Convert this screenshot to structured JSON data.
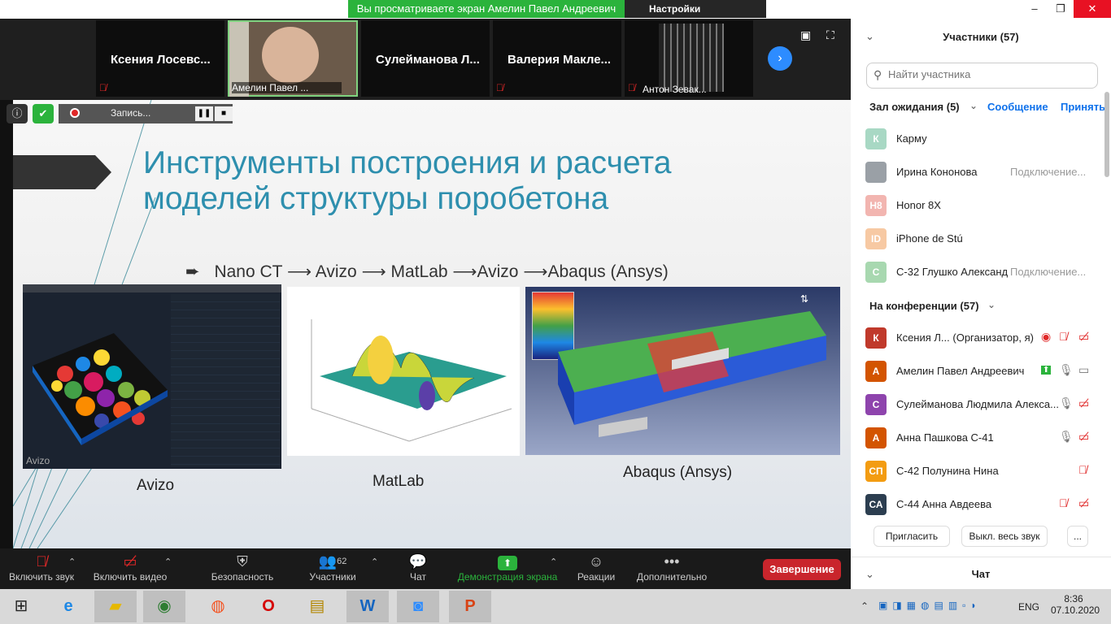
{
  "top": {
    "banner": "Вы просматриваете экран Амелин Павел Андреевич",
    "view_settings": "Настройки просмотра"
  },
  "videos": [
    {
      "name": "Ксения  Лосевс..."
    },
    {
      "name": "Амелин Павел ..."
    },
    {
      "name": "Сулейманова  Л..."
    },
    {
      "name": "Валерия  Макле..."
    },
    {
      "name": "Антон Зевак..."
    }
  ],
  "recording": {
    "label": "Запись..."
  },
  "slide": {
    "title_line1": "Инструменты построения и расчета",
    "title_line2": "моделей структуры поробетона",
    "pipeline": [
      "Nano CT",
      "Avizo",
      "MatLab",
      "Avizo",
      "Abaqus (Ansys)"
    ],
    "captions": {
      "avizo": "Avizo",
      "matlab": "MatLab",
      "abaqus": "Abaqus (Ansys)"
    },
    "avizo_logo": "Avizo"
  },
  "panel": {
    "title": "Участники (57)",
    "search_placeholder": "Найти участника",
    "waiting_label": "Зал ожидания (5)",
    "message_btn": "Сообщение",
    "accept_btn": "Принять",
    "waiting": [
      {
        "initials": "К",
        "name": "Карму",
        "status": "",
        "color": "#a8d8c4"
      },
      {
        "initials": "",
        "name": "Ирина Кононова",
        "status": "Подключение...",
        "color": "#9aa0a6"
      },
      {
        "initials": "H8",
        "name": "Honor 8X",
        "status": "",
        "color": "#f2b5b0"
      },
      {
        "initials": "ID",
        "name": "iPhone de Stú",
        "status": "",
        "color": "#f7c9a3"
      },
      {
        "initials": "C",
        "name": "С-32 Глушко Александ",
        "status": "Подключение...",
        "color": "#a8d8b0"
      }
    ],
    "conference_label": "На конференции (57)",
    "conference": [
      {
        "initials": "К",
        "name": "Ксения Л...  (Организатор, я)",
        "color": "#c0392b"
      },
      {
        "initials": "А",
        "name": "Амелин Павел Андреевич",
        "color": "#d35400"
      },
      {
        "initials": "С",
        "name": "Сулейманова Людмила Алекса...",
        "color": "#8e44ad"
      },
      {
        "initials": "А",
        "name": "Анна Пашкова С-41",
        "color": "#d35400"
      },
      {
        "initials": "СП",
        "name": "С-42 Полунина Нина",
        "color": "#f39c12"
      },
      {
        "initials": "СА",
        "name": "С-44 Анна Авдеева",
        "color": "#2c3e50"
      }
    ],
    "invite_btn": "Пригласить",
    "mute_all_btn": "Выкл. весь звук",
    "more_btn": "...",
    "chat_label": "Чат"
  },
  "toolbar": {
    "unmute": "Включить звук",
    "start_video": "Включить видео",
    "security": "Безопасность",
    "participants": "Участники",
    "participants_count": "62",
    "chat": "Чат",
    "share": "Демонстрация экрана",
    "reactions": "Реакции",
    "more": "Дополнительно",
    "end": "Завершение"
  },
  "taskbar": {
    "lang": "ENG",
    "time": "8:36",
    "date": "07.10.2020"
  }
}
